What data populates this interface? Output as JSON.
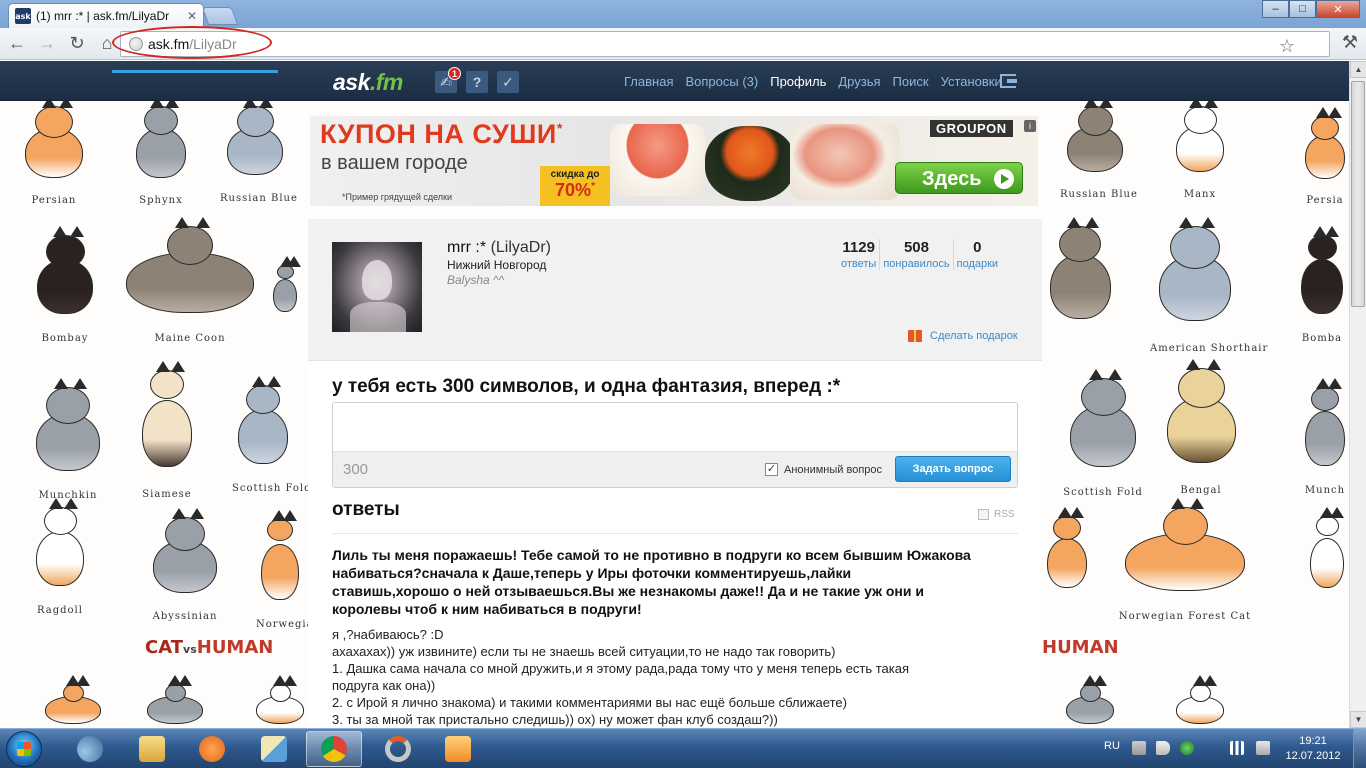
{
  "browser": {
    "tab_title": "(1) mrr :* | ask.fm/LilyaDr",
    "favicon_text": "ask",
    "url_host": "ask.fm",
    "url_path": "/LilyaDr",
    "buttons": {
      "minimize": "–",
      "maximize": "□",
      "close": "✕",
      "back": "←",
      "forward": "→",
      "reload": "↻",
      "home": "⌂",
      "star": "☆",
      "wrench": "⚒"
    }
  },
  "site": {
    "logo_main": "ask",
    "logo_dot": ".fm",
    "notification_count": "1",
    "nav_icons": [
      "thumbs-up-icon",
      "question-icon",
      "bird-icon"
    ],
    "nav_icon_glyphs": [
      "✍",
      "?",
      "✓"
    ],
    "menu": [
      {
        "label": "Главная",
        "active": false
      },
      {
        "label": "Вопросы (3)",
        "active": false
      },
      {
        "label": "Профиль",
        "active": true
      },
      {
        "label": "Друзья",
        "active": false
      },
      {
        "label": "Поиск",
        "active": false
      },
      {
        "label": "Установки",
        "active": false
      }
    ],
    "accent_color": "#35a0dc"
  },
  "ad": {
    "title": "КУПОН НА СУШИ",
    "title_mark": "*",
    "subtitle": "в вашем городе",
    "note": "*Пример грядущей сделки",
    "discount_label": "скидка до",
    "discount_value": "70%",
    "discount_mark": "*",
    "brand": "GROUPON",
    "button": "Здесь",
    "info": "i"
  },
  "profile": {
    "name": "mrr :*",
    "nickname": "(LilyaDr)",
    "city": "Нижний Новгород",
    "status": "Balysha ^^",
    "stats": [
      {
        "value": "1129",
        "label": "ответы"
      },
      {
        "value": "508",
        "label": "понравилось"
      },
      {
        "value": "0",
        "label": "подарки"
      }
    ],
    "gift_link": "Сделать подарок"
  },
  "ask": {
    "title": "у тебя есть 300 символов, и одна фантазия, вперед :*",
    "input_value": "",
    "counter": "300",
    "anonymous_label": "Анонимный вопрос",
    "anonymous_checked": "✓",
    "button": "Задать вопрос"
  },
  "answers": {
    "title": "ответы",
    "rss": "RSS",
    "question": "Лиль ты меня поражаешь! Тебе самой то не противно в подруги ко всем бывшим Южакова набиваться?сначала к Даше,теперь у Иры фоточки комментируешь,лайки ставишь,хорошо о ней отзываешься.Вы же незнакомы даже!! Да и не такие уж они и королевы чтоб к ним набиваться в подруги!",
    "answer_lines": [
      "я ,?набиваюсь? :D",
      "ахахахах)) уж извините) если ты не знаешь всей ситуации,то не надо так говорить)",
      "1. Дашка сама начала со мной дружить,и я этому рада,рада тому что у меня теперь есть такая",
      "подруга как она))",
      "2. с Ирой я лично знакома) и такими комментариями вы нас ещё больше сближаете)",
      "3. ты за мной так пристально следишь)) ох) ну может фан клуб создаш?))"
    ]
  },
  "background": {
    "cat_labels": [
      "Persian",
      "Sphynx",
      "Russian Blue",
      "Bombay",
      "Maine Coon",
      "Munchkin",
      "Siamese",
      "Scottish Fold",
      "Ragdoll",
      "Abyssinian",
      "Norwegian",
      "Russian Blue",
      "Manx",
      "Persia",
      "American Shorthair",
      "Bomba",
      "Scottish Fold",
      "Bengal",
      "Munch",
      "Norwegian Forest Cat"
    ],
    "brand_cat": "CAT",
    "brand_vs": "vs",
    "brand_human": "HUMAN",
    "brand_human_right": "HUMAN"
  },
  "taskbar": {
    "language": "RU",
    "time": "19:21",
    "date": "12.07.2012",
    "apps": [
      "explorer-app-icon",
      "folder-app-icon",
      "mail-app-icon",
      "paint-app-icon",
      "chrome-app-icon",
      "sync-app-icon",
      "media-app-icon"
    ]
  }
}
